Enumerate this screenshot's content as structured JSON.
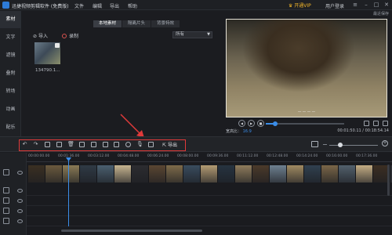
{
  "app": {
    "title": "迅捷视频剪辑软件 (免费版)",
    "menu": [
      "文件",
      "编辑",
      "导出",
      "帮助"
    ],
    "vip_label": "♛ 开通VIP",
    "login_label": "用户登录"
  },
  "sidebar": {
    "items": [
      "素材",
      "文字",
      "滤镜",
      "叠附",
      "转场",
      "动画",
      "配乐"
    ]
  },
  "media": {
    "tabs": [
      "本地素材",
      "隔离片头",
      "背景特效"
    ],
    "import_label": "导入",
    "record_label": "录制",
    "filter_value": "所有",
    "file_name": "134790.1..."
  },
  "preview": {
    "title": "最近保存",
    "subtitle": "— — — —",
    "ratio_label": "宽高比：",
    "ratio_value": "16:9",
    "time_readout": "00:01:50.11 / 00:18:54.14",
    "progress": 0.12
  },
  "toolbar": {
    "export_label": "导出",
    "tools": [
      "undo-icon",
      "redo-icon",
      "edit-icon",
      "copy-icon",
      "delete-icon",
      "crop-icon",
      "freeze-icon",
      "mosaic-icon",
      "caption-icon",
      "speed-icon",
      "voice-icon",
      "split-icon"
    ],
    "zoom": 0.22
  },
  "timeline": {
    "ticks": [
      "00:00:00.00",
      "00:01:36.00",
      "00:03:12.00",
      "00:04:48.00",
      "00:06:24.00",
      "00:08:00.00",
      "00:09:36.00",
      "00:11:12.00",
      "00:12:48.00",
      "00:14:24.00",
      "00:16:00.00",
      "00:17:36.00"
    ],
    "colors": [
      "#3a2f22",
      "#6b5a3e",
      "#8a7a55",
      "#2f3a45",
      "#4a5f6f",
      "#c7b590",
      "#2c2c30",
      "#5a4632",
      "#7e6b4a",
      "#394c5e",
      "#b39b72",
      "#263340",
      "#8f7c5c",
      "#4b3a2a",
      "#6e8090",
      "#a08a62",
      "#30404f",
      "#7a6648",
      "#52606c",
      "#c4ad84",
      "#3c2e22"
    ]
  }
}
